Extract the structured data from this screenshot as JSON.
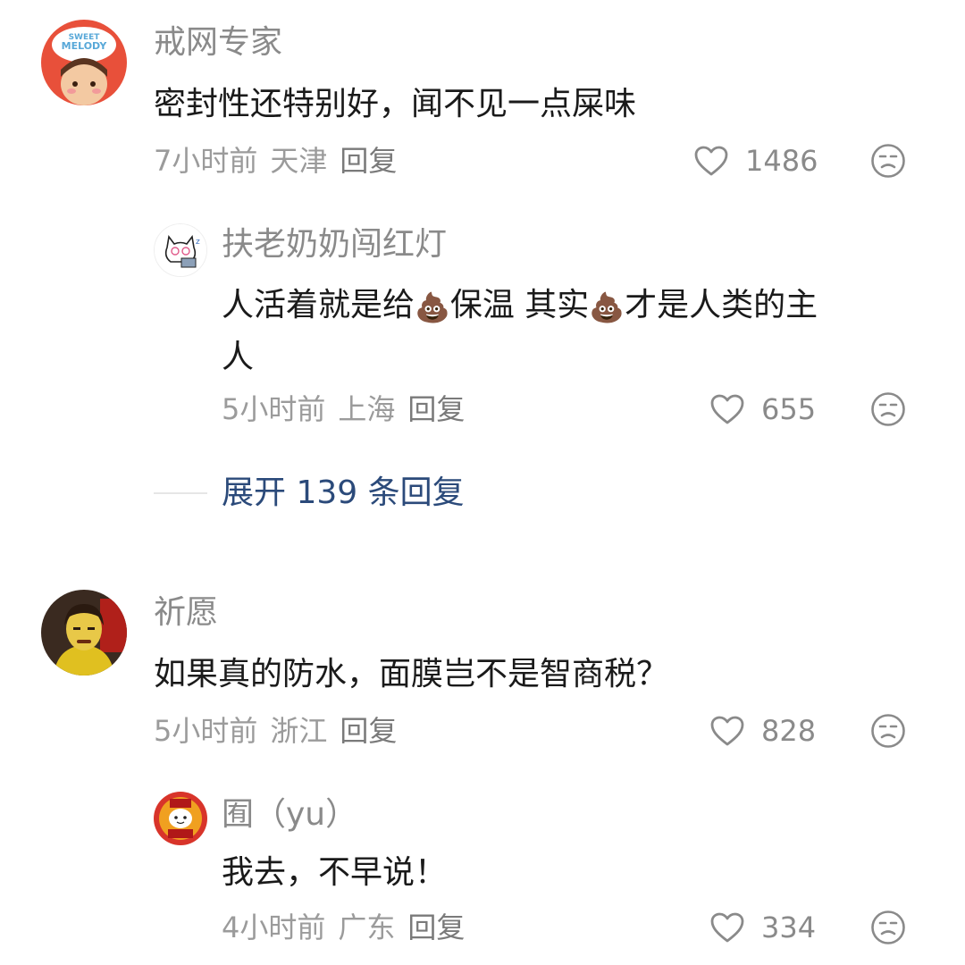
{
  "comments": [
    {
      "user": "戒网专家",
      "avatar_text": {
        "line1": "SWEET",
        "line2": "MELODY"
      },
      "text": "密封性还特别好，闻不见一点屎味",
      "time": "7小时前",
      "location": "天津",
      "reply_label": "回复",
      "likes": "1486",
      "replies": [
        {
          "user": "扶老奶奶闯红灯",
          "text_parts": [
            "人活着就是给",
            "💩",
            "保温 其实",
            "💩",
            "才是人类的主",
            "人"
          ],
          "time": "5小时前",
          "location": "上海",
          "reply_label": "回复",
          "likes": "655"
        }
      ],
      "expand_label": "展开 139 条回复"
    },
    {
      "user": "祈愿",
      "text": "如果真的防水，面膜岂不是智商税？",
      "time": "5小时前",
      "location": "浙江",
      "reply_label": "回复",
      "likes": "828",
      "replies": [
        {
          "user": "囿（yu）",
          "text": "我去，不早说！",
          "time": "4小时前",
          "location": "广东",
          "reply_label": "回复",
          "likes": "334"
        }
      ]
    }
  ],
  "icons": {
    "like": "heart-outline-icon",
    "dislike": "unamused-face-icon"
  },
  "colors": {
    "username": "#8a8a8a",
    "body_text": "#1a1a1a",
    "meta_text": "#9b9b9b",
    "expand_link": "#2b4a7a",
    "divider": "#e6e6e6"
  }
}
